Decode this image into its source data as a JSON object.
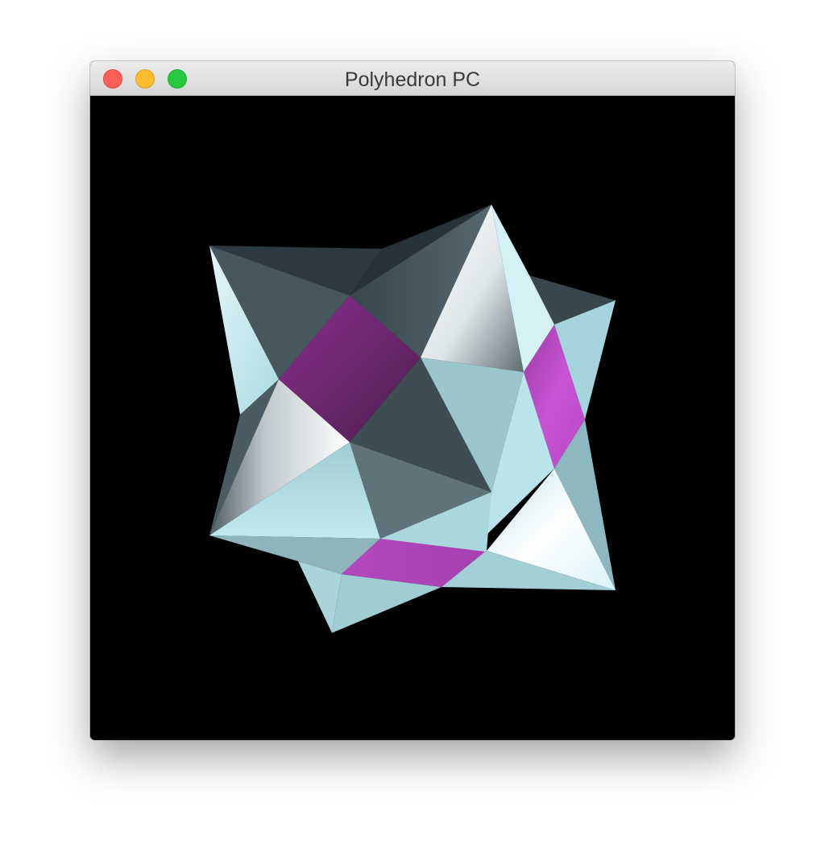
{
  "window": {
    "title": "Polyhedron PC"
  },
  "colors": {
    "background": "#000000",
    "accent_face": "#a63fb0",
    "light_face": "#b7e3ea",
    "dark_face": "#3f4f55"
  },
  "icons": {
    "close": "close-icon",
    "minimize": "minimize-icon",
    "zoom": "zoom-icon"
  }
}
